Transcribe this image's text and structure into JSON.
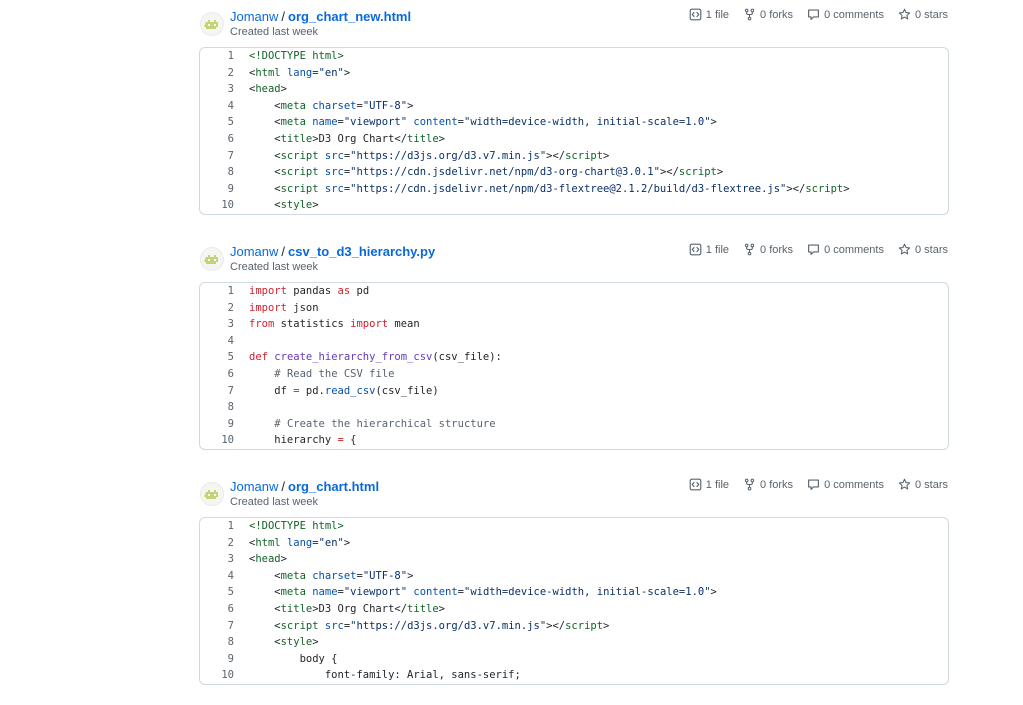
{
  "gists": [
    {
      "owner": "Jomanw",
      "slash": "/",
      "filename": "org_chart_new.html",
      "created": "Created last week",
      "stats": {
        "files": "1 file",
        "forks": "0 forks",
        "comments": "0 comments",
        "stars": "0 stars"
      },
      "lines": [
        {
          "n": "1",
          "code": [
            [
              "<!DOCTYPE html>",
              "t"
            ]
          ]
        },
        {
          "n": "2",
          "code": [
            [
              "<",
              "p"
            ],
            [
              "html",
              "t"
            ],
            [
              " ",
              "p"
            ],
            [
              "lang",
              "a"
            ],
            [
              "=",
              "p"
            ],
            [
              "\"en\"",
              "s"
            ],
            [
              ">",
              "p"
            ]
          ]
        },
        {
          "n": "3",
          "code": [
            [
              "<",
              "p"
            ],
            [
              "head",
              "t"
            ],
            [
              ">",
              "p"
            ]
          ]
        },
        {
          "n": "4",
          "code": [
            [
              "    <",
              "p"
            ],
            [
              "meta",
              "t"
            ],
            [
              " ",
              "p"
            ],
            [
              "charset",
              "a"
            ],
            [
              "=",
              "p"
            ],
            [
              "\"UTF-8\"",
              "s"
            ],
            [
              ">",
              "p"
            ]
          ]
        },
        {
          "n": "5",
          "code": [
            [
              "    <",
              "p"
            ],
            [
              "meta",
              "t"
            ],
            [
              " ",
              "p"
            ],
            [
              "name",
              "a"
            ],
            [
              "=",
              "p"
            ],
            [
              "\"viewport\"",
              "s"
            ],
            [
              " ",
              "p"
            ],
            [
              "content",
              "a"
            ],
            [
              "=",
              "p"
            ],
            [
              "\"width=device-width, initial-scale=1.0\"",
              "s"
            ],
            [
              ">",
              "p"
            ]
          ]
        },
        {
          "n": "6",
          "code": [
            [
              "    <",
              "p"
            ],
            [
              "title",
              "t"
            ],
            [
              ">D3 Org Chart</",
              "p"
            ],
            [
              "title",
              "t"
            ],
            [
              ">",
              "p"
            ]
          ]
        },
        {
          "n": "7",
          "code": [
            [
              "    <",
              "p"
            ],
            [
              "script",
              "t"
            ],
            [
              " ",
              "p"
            ],
            [
              "src",
              "a"
            ],
            [
              "=",
              "p"
            ],
            [
              "\"https://d3js.org/d3.v7.min.js\"",
              "s"
            ],
            [
              "></",
              "p"
            ],
            [
              "script",
              "t"
            ],
            [
              ">",
              "p"
            ]
          ]
        },
        {
          "n": "8",
          "code": [
            [
              "    <",
              "p"
            ],
            [
              "script",
              "t"
            ],
            [
              " ",
              "p"
            ],
            [
              "src",
              "a"
            ],
            [
              "=",
              "p"
            ],
            [
              "\"https://cdn.jsdelivr.net/npm/d3-org-chart@3.0.1\"",
              "s"
            ],
            [
              "></",
              "p"
            ],
            [
              "script",
              "t"
            ],
            [
              ">",
              "p"
            ]
          ]
        },
        {
          "n": "9",
          "code": [
            [
              "    <",
              "p"
            ],
            [
              "script",
              "t"
            ],
            [
              " ",
              "p"
            ],
            [
              "src",
              "a"
            ],
            [
              "=",
              "p"
            ],
            [
              "\"https://cdn.jsdelivr.net/npm/d3-flextree@2.1.2/build/d3-flextree.js\"",
              "s"
            ],
            [
              "></",
              "p"
            ],
            [
              "script",
              "t"
            ],
            [
              ">",
              "p"
            ]
          ]
        },
        {
          "n": "10",
          "code": [
            [
              "    <",
              "p"
            ],
            [
              "style",
              "t"
            ],
            [
              ">",
              "p"
            ]
          ]
        }
      ]
    },
    {
      "owner": "Jomanw",
      "slash": "/",
      "filename": "csv_to_d3_hierarchy.py",
      "created": "Created last week",
      "stats": {
        "files": "1 file",
        "forks": "0 forks",
        "comments": "0 comments",
        "stars": "0 stars"
      },
      "lines": [
        {
          "n": "1",
          "code": [
            [
              "import",
              "k"
            ],
            [
              " pandas ",
              "p"
            ],
            [
              "as",
              "k"
            ],
            [
              " pd",
              "p"
            ]
          ]
        },
        {
          "n": "2",
          "code": [
            [
              "import",
              "k"
            ],
            [
              " json",
              "p"
            ]
          ]
        },
        {
          "n": "3",
          "code": [
            [
              "from",
              "k"
            ],
            [
              " statistics ",
              "p"
            ],
            [
              "import",
              "k"
            ],
            [
              " mean",
              "p"
            ]
          ]
        },
        {
          "n": "4",
          "code": []
        },
        {
          "n": "5",
          "code": [
            [
              "def",
              "k"
            ],
            [
              " ",
              "p"
            ],
            [
              "create_hierarchy_from_csv",
              "f"
            ],
            [
              "(csv_file):",
              "p"
            ]
          ]
        },
        {
          "n": "6",
          "code": [
            [
              "    ",
              "p"
            ],
            [
              "# Read the CSV file",
              "c"
            ]
          ]
        },
        {
          "n": "7",
          "code": [
            [
              "    df ",
              "p"
            ],
            [
              "=",
              "k"
            ],
            [
              " pd.",
              "p"
            ],
            [
              "read_csv",
              "a"
            ],
            [
              "(csv_file)",
              "p"
            ]
          ]
        },
        {
          "n": "8",
          "code": []
        },
        {
          "n": "9",
          "code": [
            [
              "    ",
              "p"
            ],
            [
              "# Create the hierarchical structure",
              "c"
            ]
          ]
        },
        {
          "n": "10",
          "code": [
            [
              "    hierarchy ",
              "p"
            ],
            [
              "=",
              "k"
            ],
            [
              " {",
              "p"
            ]
          ]
        }
      ]
    },
    {
      "owner": "Jomanw",
      "slash": "/",
      "filename": "org_chart.html",
      "created": "Created last week",
      "stats": {
        "files": "1 file",
        "forks": "0 forks",
        "comments": "0 comments",
        "stars": "0 stars"
      },
      "lines": [
        {
          "n": "1",
          "code": [
            [
              "<!DOCTYPE html>",
              "t"
            ]
          ]
        },
        {
          "n": "2",
          "code": [
            [
              "<",
              "p"
            ],
            [
              "html",
              "t"
            ],
            [
              " ",
              "p"
            ],
            [
              "lang",
              "a"
            ],
            [
              "=",
              "p"
            ],
            [
              "\"en\"",
              "s"
            ],
            [
              ">",
              "p"
            ]
          ]
        },
        {
          "n": "3",
          "code": [
            [
              "<",
              "p"
            ],
            [
              "head",
              "t"
            ],
            [
              ">",
              "p"
            ]
          ]
        },
        {
          "n": "4",
          "code": [
            [
              "    <",
              "p"
            ],
            [
              "meta",
              "t"
            ],
            [
              " ",
              "p"
            ],
            [
              "charset",
              "a"
            ],
            [
              "=",
              "p"
            ],
            [
              "\"UTF-8\"",
              "s"
            ],
            [
              ">",
              "p"
            ]
          ]
        },
        {
          "n": "5",
          "code": [
            [
              "    <",
              "p"
            ],
            [
              "meta",
              "t"
            ],
            [
              " ",
              "p"
            ],
            [
              "name",
              "a"
            ],
            [
              "=",
              "p"
            ],
            [
              "\"viewport\"",
              "s"
            ],
            [
              " ",
              "p"
            ],
            [
              "content",
              "a"
            ],
            [
              "=",
              "p"
            ],
            [
              "\"width=device-width, initial-scale=1.0\"",
              "s"
            ],
            [
              ">",
              "p"
            ]
          ]
        },
        {
          "n": "6",
          "code": [
            [
              "    <",
              "p"
            ],
            [
              "title",
              "t"
            ],
            [
              ">D3 Org Chart</",
              "p"
            ],
            [
              "title",
              "t"
            ],
            [
              ">",
              "p"
            ]
          ]
        },
        {
          "n": "7",
          "code": [
            [
              "    <",
              "p"
            ],
            [
              "script",
              "t"
            ],
            [
              " ",
              "p"
            ],
            [
              "src",
              "a"
            ],
            [
              "=",
              "p"
            ],
            [
              "\"https://d3js.org/d3.v7.min.js\"",
              "s"
            ],
            [
              "></",
              "p"
            ],
            [
              "script",
              "t"
            ],
            [
              ">",
              "p"
            ]
          ]
        },
        {
          "n": "8",
          "code": [
            [
              "    <",
              "p"
            ],
            [
              "style",
              "t"
            ],
            [
              ">",
              "p"
            ]
          ]
        },
        {
          "n": "9",
          "code": [
            [
              "        body {",
              "p"
            ]
          ]
        },
        {
          "n": "10",
          "code": [
            [
              "            font-family: Arial, sans-serif;",
              "p"
            ]
          ]
        }
      ]
    }
  ]
}
